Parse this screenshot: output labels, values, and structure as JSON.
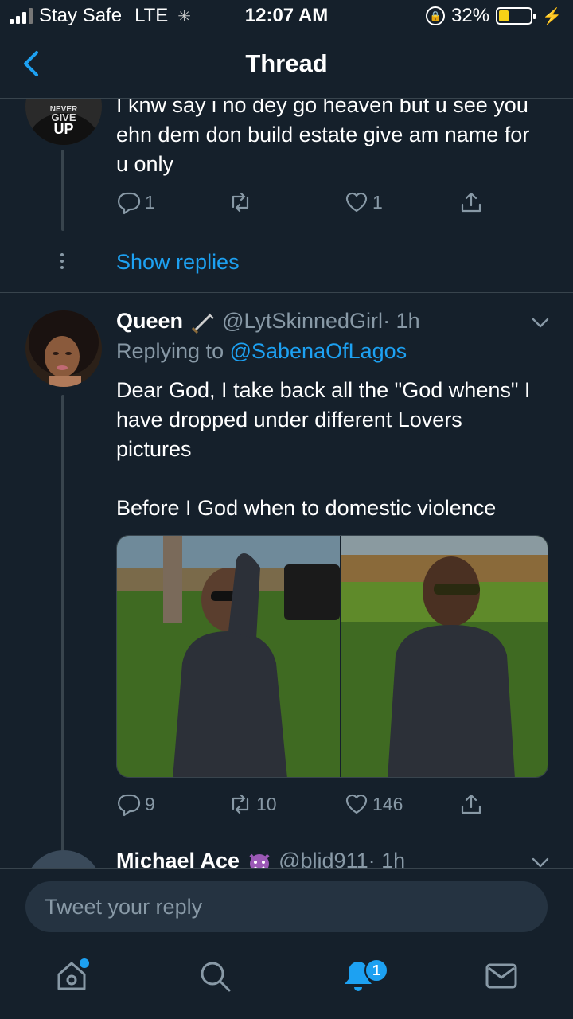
{
  "status_bar": {
    "carrier": "Stay Safe",
    "network": "LTE",
    "time": "12:07 AM",
    "battery": "32%",
    "battery_level": 0.32
  },
  "header": {
    "title": "Thread"
  },
  "tweet_prev": {
    "avatar_text": [
      "NEVER",
      "GIVE",
      "UP"
    ],
    "text": "I knw say i no dey go heaven but u see you ehn dem don build estate give am name for u only",
    "reply_count": "1",
    "like_count": "1",
    "show_replies": "Show replies"
  },
  "tweet_main": {
    "name": "Queen",
    "handle": "@LytSkinnedGirl",
    "time": "· 1h",
    "replying_prefix": "Replying to ",
    "replying_to": "@SabenaOfLagos",
    "text_p1": "Dear God, I take back all the \"God whens\" I have dropped under different Lovers pictures",
    "text_p2": "Before I God when to domestic violence",
    "reply_count": "9",
    "retweet_count": "10",
    "like_count": "146"
  },
  "tweet_next": {
    "name": "Michael Ace",
    "handle": "@blid911",
    "time": "· 1h"
  },
  "reply_bar": {
    "placeholder": "Tweet your reply"
  },
  "tabbar": {
    "notification_badge": "1"
  },
  "colors": {
    "background": "#15202b",
    "accent": "#1da1f2",
    "muted": "#8899a6",
    "border": "#38444d"
  }
}
